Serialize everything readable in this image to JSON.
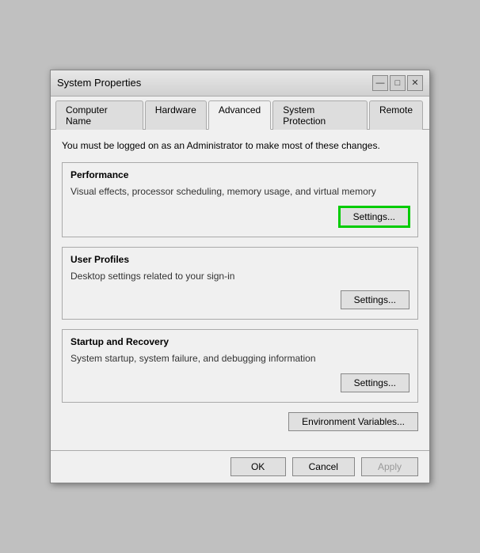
{
  "window": {
    "title": "System Properties"
  },
  "titlebar": {
    "close_label": "✕",
    "minimize_label": "—",
    "maximize_label": "□"
  },
  "tabs": [
    {
      "label": "Computer Name",
      "active": false
    },
    {
      "label": "Hardware",
      "active": false
    },
    {
      "label": "Advanced",
      "active": true
    },
    {
      "label": "System Protection",
      "active": false
    },
    {
      "label": "Remote",
      "active": false
    }
  ],
  "content": {
    "admin_notice": "You must be logged on as an Administrator to make most of these changes.",
    "sections": [
      {
        "title": "Performance",
        "description": "Visual effects, processor scheduling, memory usage, and virtual memory",
        "settings_label": "Settings...",
        "highlighted": true
      },
      {
        "title": "User Profiles",
        "description": "Desktop settings related to your sign-in",
        "settings_label": "Settings...",
        "highlighted": false
      },
      {
        "title": "Startup and Recovery",
        "description": "System startup, system failure, and debugging information",
        "settings_label": "Settings...",
        "highlighted": false
      }
    ],
    "env_button_label": "Environment Variables...",
    "buttons": {
      "ok": "OK",
      "cancel": "Cancel",
      "apply": "Apply"
    }
  }
}
